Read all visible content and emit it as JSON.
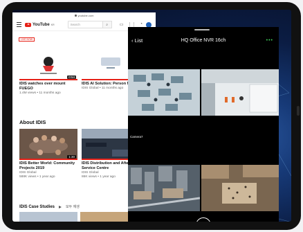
{
  "youtube": {
    "url": "youtube.com",
    "logo": "YouTube",
    "logo_region": "KR",
    "search_placeholder": "Search",
    "live_badge": "LIVE NOW",
    "videos_top": [
      {
        "title": "IDIS watches over mount FUEGO",
        "meta": "1.4M views • 11 months ago",
        "duration": "0:54"
      },
      {
        "title": "IDIS AI Solution: Person Match",
        "meta": "IDIS Global • 11 months ago",
        "duration": ""
      }
    ],
    "about_heading": "About IDIS",
    "videos_about": [
      {
        "title": "IDIS Better World: Community Projects 2019",
        "meta1": "IDIS Global",
        "meta2": "588K views • 1 year ago",
        "duration": "1:30"
      },
      {
        "title": "IDIS Distribution and After Sales Service Centre",
        "meta1": "IDIS Global",
        "meta2": "86K views • 1 year ago",
        "duration": ""
      }
    ],
    "case_studies": "IDIS Case Studies",
    "play_all": "모두 재생"
  },
  "nvr": {
    "back_label": "List",
    "title": "HQ Office NVR 16ch",
    "more_label": "•••",
    "camera_label": "Camera7"
  },
  "colors": {
    "youtube_red": "#e62117",
    "accent_green": "#3ecf5a"
  }
}
